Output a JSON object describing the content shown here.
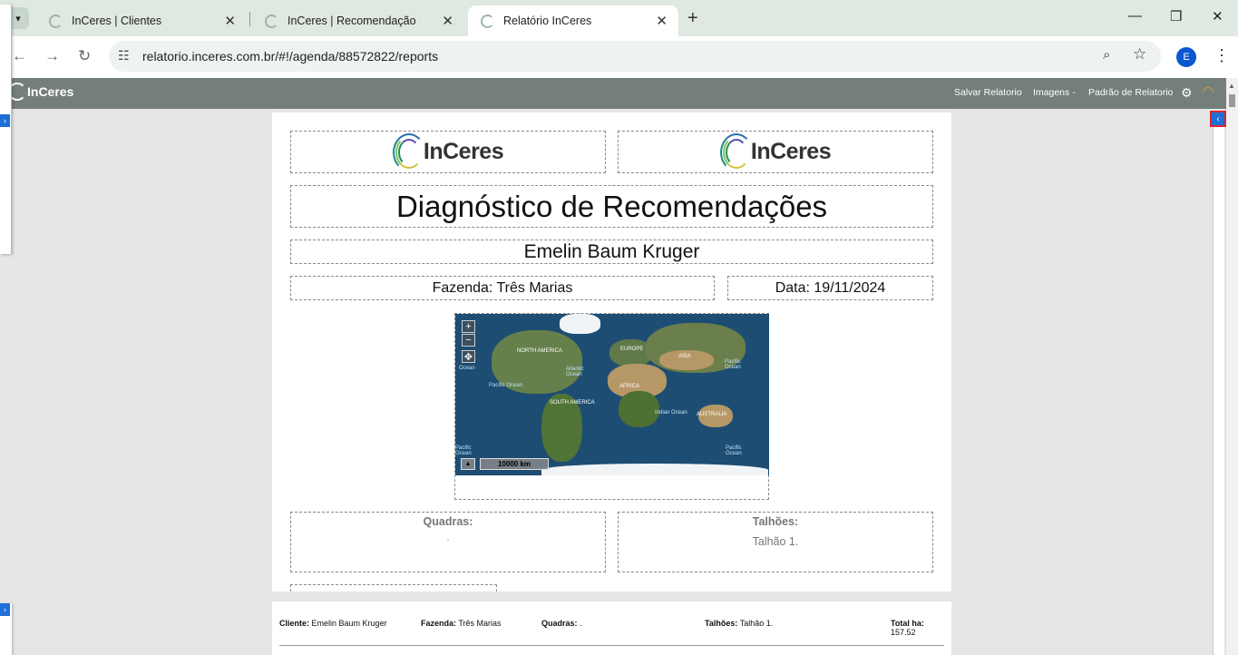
{
  "browser": {
    "tabs": [
      {
        "title": "InCeres | Clientes",
        "active": false
      },
      {
        "title": "InCeres | Recomendação",
        "active": false
      },
      {
        "title": "Relatório InCeres",
        "active": true
      }
    ],
    "url": "relatorio.inceres.com.br/#!/agenda/88572822/reports",
    "profile_initial": "E",
    "icons": {
      "tab_search": "chevron-down-icon",
      "close": "close-icon",
      "new_tab": "plus-icon",
      "back": "arrow-left-icon",
      "forward": "arrow-right-icon",
      "reload": "reload-icon",
      "site_info": "tune-icon",
      "zoom": "magnifier-icon",
      "bookmark": "star-icon",
      "menu": "kebab-icon"
    }
  },
  "app": {
    "logo_text": "InCeres",
    "menu": {
      "save": "Salvar Relatorio",
      "images": "Imagens -",
      "default": "Padrão de Relatorio"
    },
    "colors": {
      "header_bg": "#747f79",
      "toggle_blue": "#1e6fd9",
      "highlight_red": "#e0242a"
    }
  },
  "report": {
    "logo_left": "InCeres",
    "logo_right": "InCeres",
    "title": "Diagnóstico de Recomendações",
    "client_name": "Emelin Baum Kruger",
    "farm": "Fazenda: Três Marias",
    "date": "Data: 19/11/2024",
    "map": {
      "zoom_in": "+",
      "zoom_out": "−",
      "pan": "✥",
      "scale": "10000 km",
      "north": "▲",
      "labels": {
        "north_america": "NORTH AMERICA",
        "europe": "EUROPE",
        "asia": "ASIA",
        "africa": "AFRICA",
        "south_america": "SOUTH AMERICA",
        "australia": "AUSTRALIA",
        "atlantic": "Atlantic Ocean",
        "pacific_left": "Pacific Ocean",
        "pacific_right": "Pacific Ocean",
        "indian": "Indian Ocean",
        "ocean_left": "Ocean",
        "pacific_bl": "Pacific Ocean",
        "pacific_br": "Pacific Ocean"
      }
    },
    "quadras": {
      "label": "Quadras:",
      "value": "."
    },
    "talhoes": {
      "label": "Talhões:",
      "value": "Talhão 1."
    }
  },
  "footer": {
    "cliente_label": "Cliente:",
    "cliente_value": "Emelin Baum Kruger",
    "fazenda_label": "Fazenda:",
    "fazenda_value": "Três Marias",
    "quadras_label": "Quadras:",
    "quadras_value": ".",
    "talhoes_label": "Talhões:",
    "talhoes_value": "Talhão 1.",
    "total_label": "Total ha:",
    "total_value": "157.52"
  }
}
